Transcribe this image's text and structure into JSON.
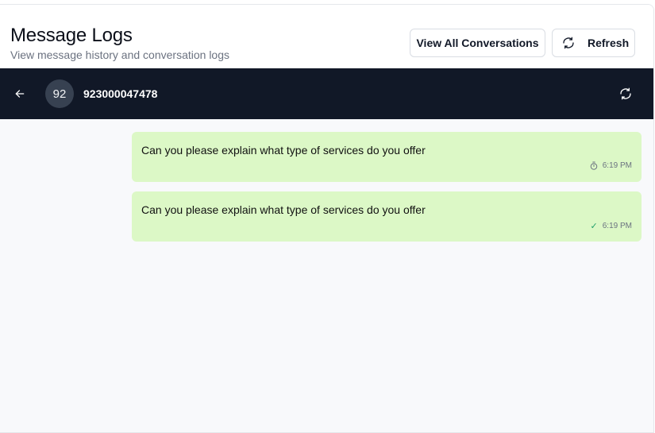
{
  "header": {
    "title": "Message Logs",
    "subtitle": "View message history and conversation logs",
    "view_all_label": "View All Conversations",
    "refresh_label": "Refresh"
  },
  "chat": {
    "avatar_text": "92",
    "contact_number": "923000047478"
  },
  "messages": [
    {
      "text": "Can you please explain what type of services do you offer",
      "time": "6:19 PM",
      "status_icon": "pending-clock-icon"
    },
    {
      "text": "Can you please explain what type of services do you offer",
      "time": "6:19 PM",
      "status_icon": "check-icon"
    }
  ],
  "colors": {
    "chat_bar": "#111827",
    "bubble": "#dcf8c6",
    "background": "#f8f9fb",
    "check": "#22a06b"
  }
}
